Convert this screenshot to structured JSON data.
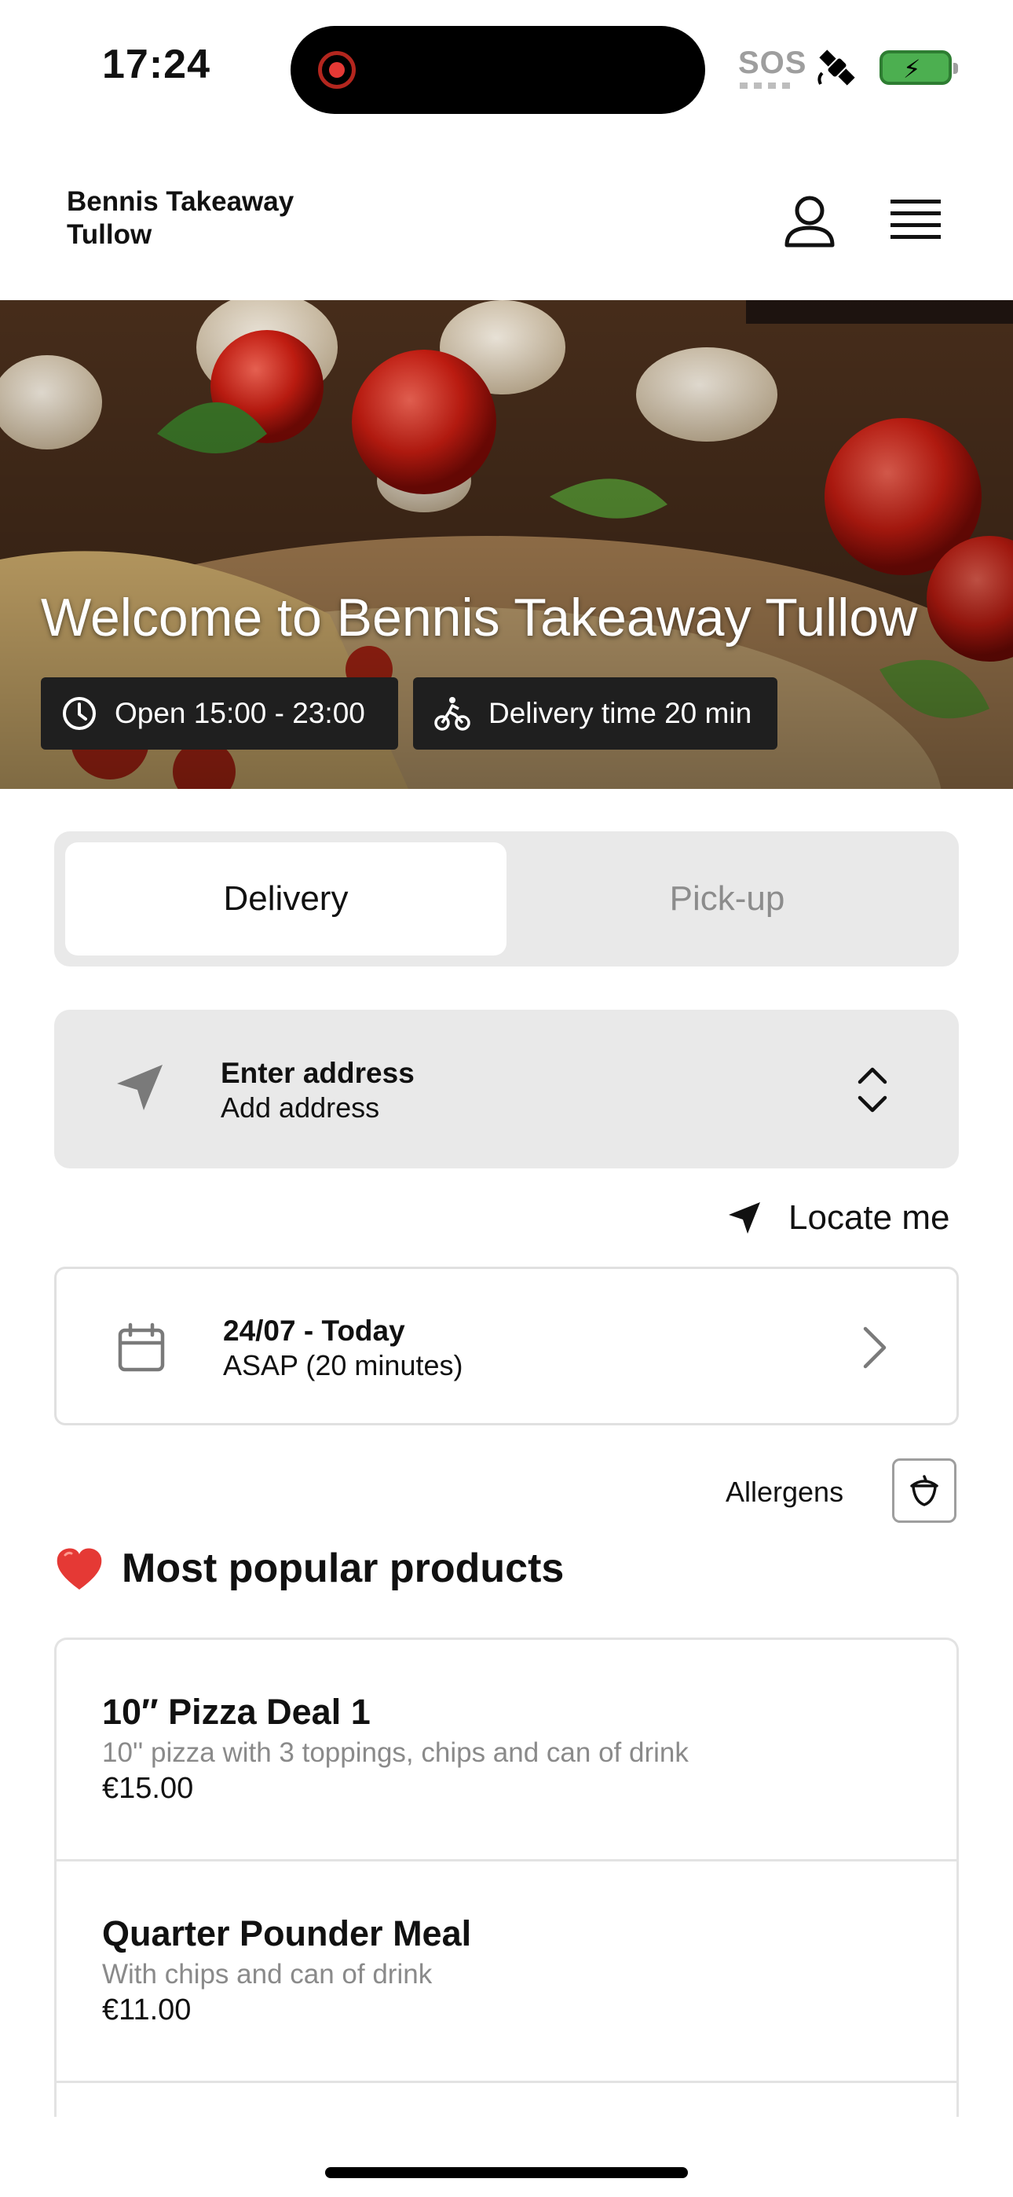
{
  "status_bar": {
    "time": "17:24",
    "sos": "SOS",
    "icons": [
      "screen-record-icon",
      "satellite-icon",
      "battery-charging-icon"
    ]
  },
  "header": {
    "brand": "Bennis Takeaway Tullow",
    "icons": [
      "user-icon",
      "hamburger-menu-icon"
    ]
  },
  "hero": {
    "title": "Welcome to Bennis Takeaway Tullow",
    "hours": "Open 15:00 - 23:00",
    "delivery_time": "Delivery time 20 min"
  },
  "mode_toggle": {
    "options": [
      "Delivery",
      "Pick-up"
    ],
    "selected": "Delivery"
  },
  "address": {
    "title": "Enter address",
    "subtitle": "Add address"
  },
  "locate": {
    "label": "Locate me"
  },
  "schedule": {
    "date": "24/07 - Today",
    "time": "ASAP (20 minutes)"
  },
  "allergens": {
    "label": "Allergens"
  },
  "popular": {
    "heading": "Most popular products",
    "products": [
      {
        "name": "10″ Pizza Deal 1",
        "description": "10'' pizza with 3 toppings, chips and can of drink",
        "price": "€15.00"
      },
      {
        "name": "Quarter Pounder Meal",
        "description": "With chips and can of drink",
        "price": "€11.00"
      }
    ]
  },
  "colors": {
    "accent_red": "#e53935",
    "toggle_bg": "#e9e9e9",
    "chip_bg": "#1f1f1f",
    "muted_text": "#8a8a8a",
    "battery_green": "#4caf50"
  }
}
